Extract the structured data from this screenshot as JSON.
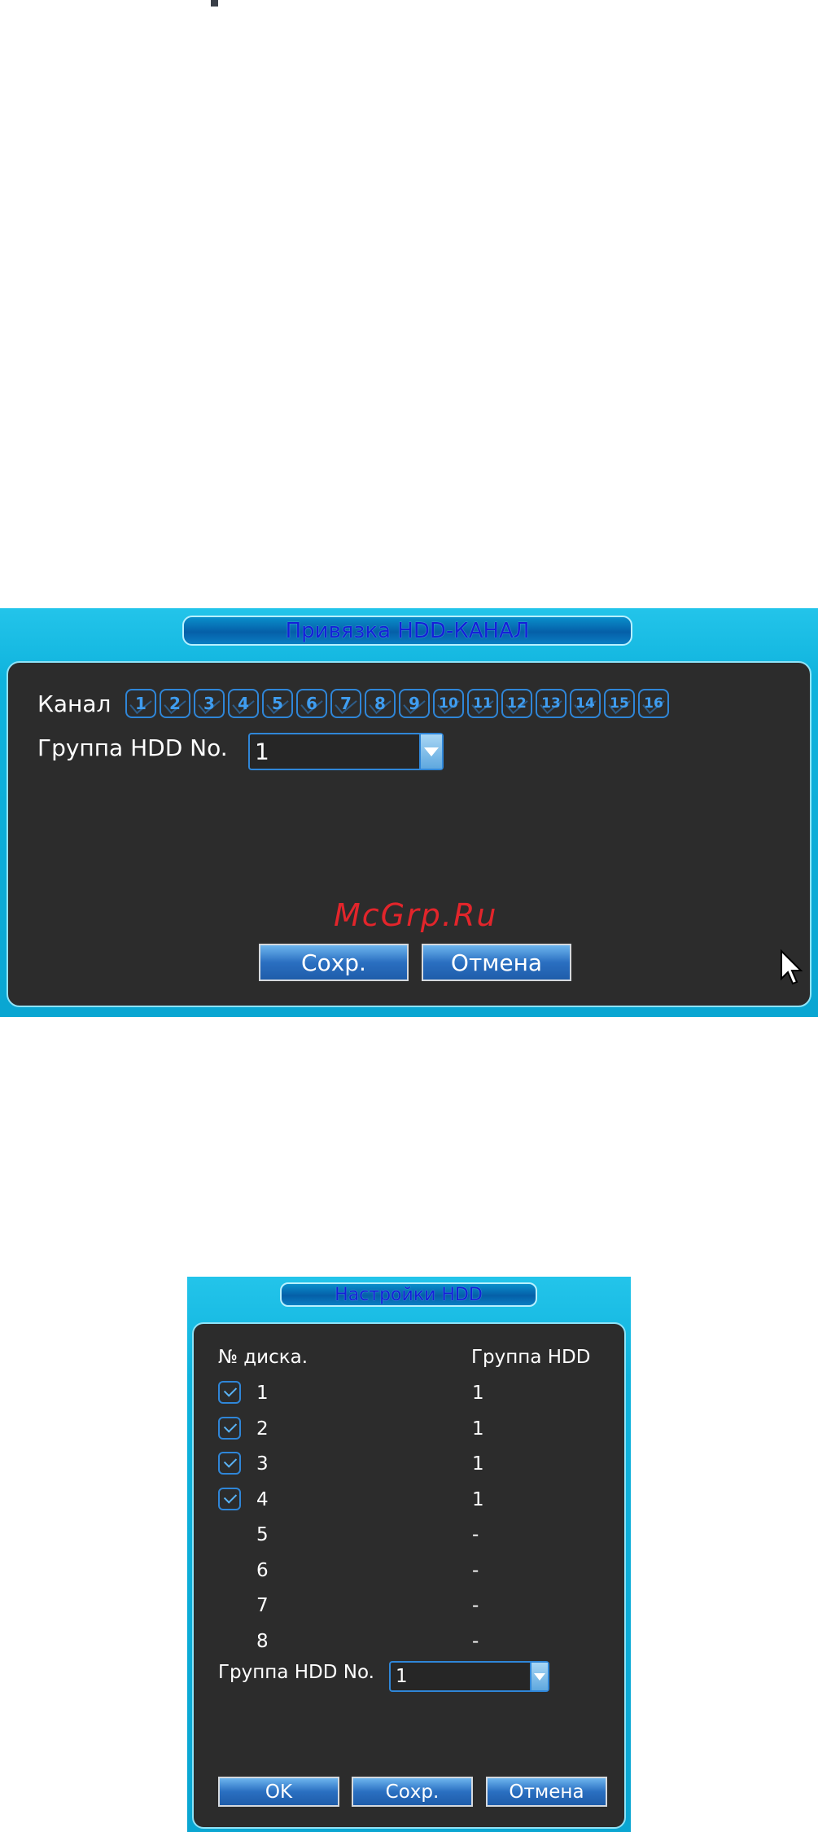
{
  "dialog1": {
    "title": "Привязка HDD-КАНАЛ",
    "channel_label": "Канал",
    "channels": [
      "1",
      "2",
      "3",
      "4",
      "5",
      "6",
      "7",
      "8",
      "9",
      "10",
      "11",
      "12",
      "13",
      "14",
      "15",
      "16"
    ],
    "hdd_group_label": "Группа HDD No.",
    "hdd_group_value": "1",
    "watermark": "McGrp.Ru",
    "save_label": "Сохр.",
    "cancel_label": "Отмена"
  },
  "dialog2": {
    "title": "Настройки HDD",
    "col_disk": "№ диска.",
    "col_group": "Группа HDD",
    "rows": [
      {
        "disk": "1",
        "group": "1",
        "checked": true
      },
      {
        "disk": "2",
        "group": "1",
        "checked": true
      },
      {
        "disk": "3",
        "group": "1",
        "checked": true
      },
      {
        "disk": "4",
        "group": "1",
        "checked": true
      },
      {
        "disk": "5",
        "group": "-",
        "checked": false
      },
      {
        "disk": "6",
        "group": "-",
        "checked": false
      },
      {
        "disk": "7",
        "group": "-",
        "checked": false
      },
      {
        "disk": "8",
        "group": "-",
        "checked": false
      }
    ],
    "hdd_group_label": "Группа HDD No.",
    "hdd_group_value": "1",
    "ok_label": "OK",
    "save_label": "Сохр.",
    "cancel_label": "Отмена"
  },
  "colors": {
    "frame_cyan": "#0fb3dd",
    "panel_dark": "#2c2c2c",
    "accent_blue": "#2f86d8",
    "title_text": "#1420d8",
    "watermark_red": "#e2252b"
  }
}
